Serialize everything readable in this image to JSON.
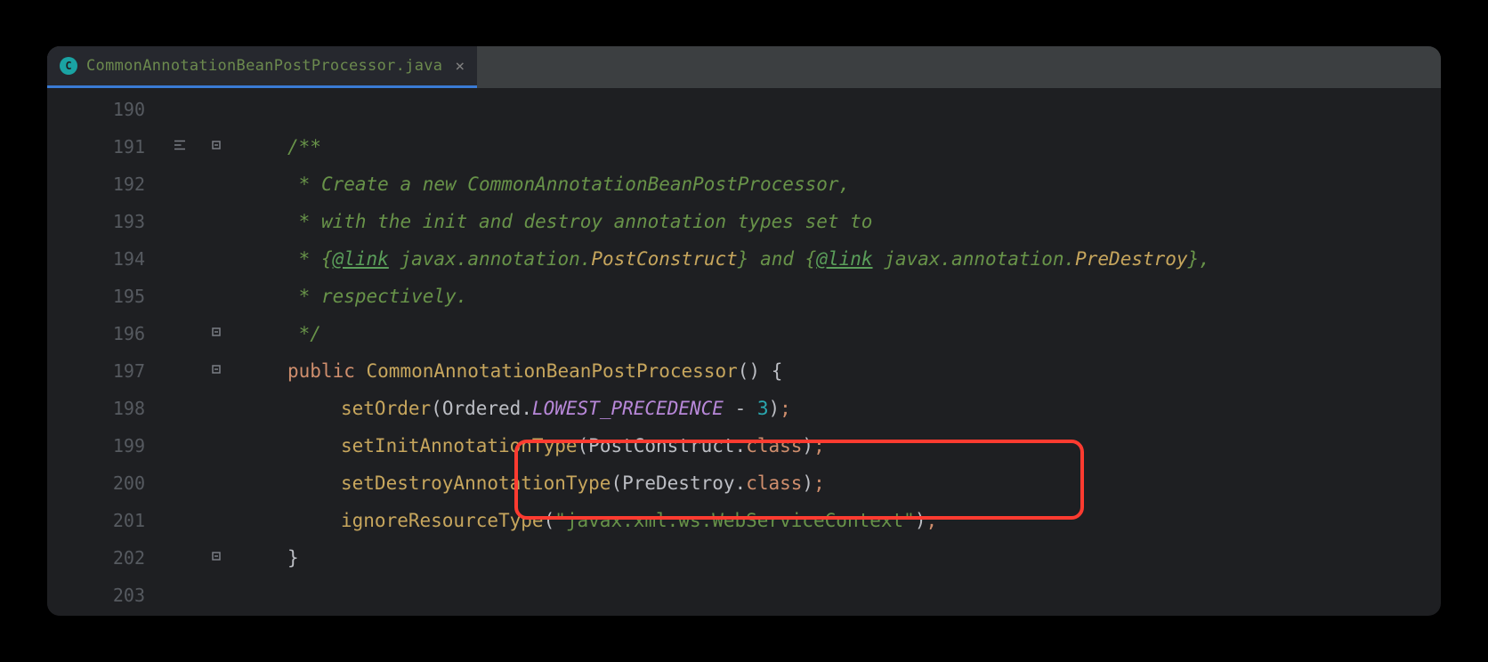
{
  "tab": {
    "icon_letter": "C",
    "label": "CommonAnnotationBeanPostProcessor.java",
    "close": "×"
  },
  "lines": {
    "n190": "190",
    "n191": "191",
    "n192": "192",
    "n193": "193",
    "n194": "194",
    "n195": "195",
    "n196": "196",
    "n197": "197",
    "n198": "198",
    "n199": "199",
    "n200": "200",
    "n201": "201",
    "n202": "202",
    "n203": "203"
  },
  "code": {
    "l191_open": "/**",
    "l192_prefix": " * ",
    "l192_text": "Create a new CommonAnnotationBeanPostProcessor,",
    "l193_prefix": " * ",
    "l193_text": "with the init and destroy annotation types set to",
    "l194_prefix": " * ",
    "l194_brace1": "{",
    "l194_link1": "@link",
    "l194_sp1": " ",
    "l194_pkg1": "javax.annotation.",
    "l194_cls1": "PostConstruct",
    "l194_brace1c": "}",
    "l194_and": " and ",
    "l194_brace2": "{",
    "l194_link2": "@link",
    "l194_sp2": " ",
    "l194_pkg2": "javax.annotation.",
    "l194_cls2": "PreDestroy",
    "l194_brace2c": "}",
    "l194_comma": ",",
    "l195_prefix": " * ",
    "l195_text": "respectively.",
    "l196_close": " */",
    "l197_public": "public",
    "l197_sp1": " ",
    "l197_name": "CommonAnnotationBeanPostProcessor",
    "l197_parens": "()",
    "l197_sp2": " ",
    "l197_brace": "{",
    "l198_guide": "",
    "l198_method": "setOrder",
    "l198_open": "(",
    "l198_cls": "Ordered",
    "l198_dot": ".",
    "l198_const": "LOWEST_PRECEDENCE",
    "l198_op": " - ",
    "l198_num": "3",
    "l198_close": ")",
    "l198_semi": ";",
    "l199_method": "setInitAnnotationType",
    "l199_open": "(",
    "l199_cls": "PostConstruct",
    "l199_dot": ".",
    "l199_field": "class",
    "l199_close": ")",
    "l199_semi": ";",
    "l200_method": "setDestroyAnnotationType",
    "l200_open": "(",
    "l200_cls": "PreDestroy",
    "l200_dot": ".",
    "l200_field": "class",
    "l200_close": ")",
    "l200_semi": ";",
    "l201_method": "ignoreResourceType",
    "l201_open": "(",
    "l201_str": "\"javax.xml.ws.WebServiceContext\"",
    "l201_close": ")",
    "l201_semi": ";",
    "l202_brace": "}"
  },
  "highlight": {
    "top": "395",
    "left": "315",
    "width": "640",
    "height": "90"
  }
}
